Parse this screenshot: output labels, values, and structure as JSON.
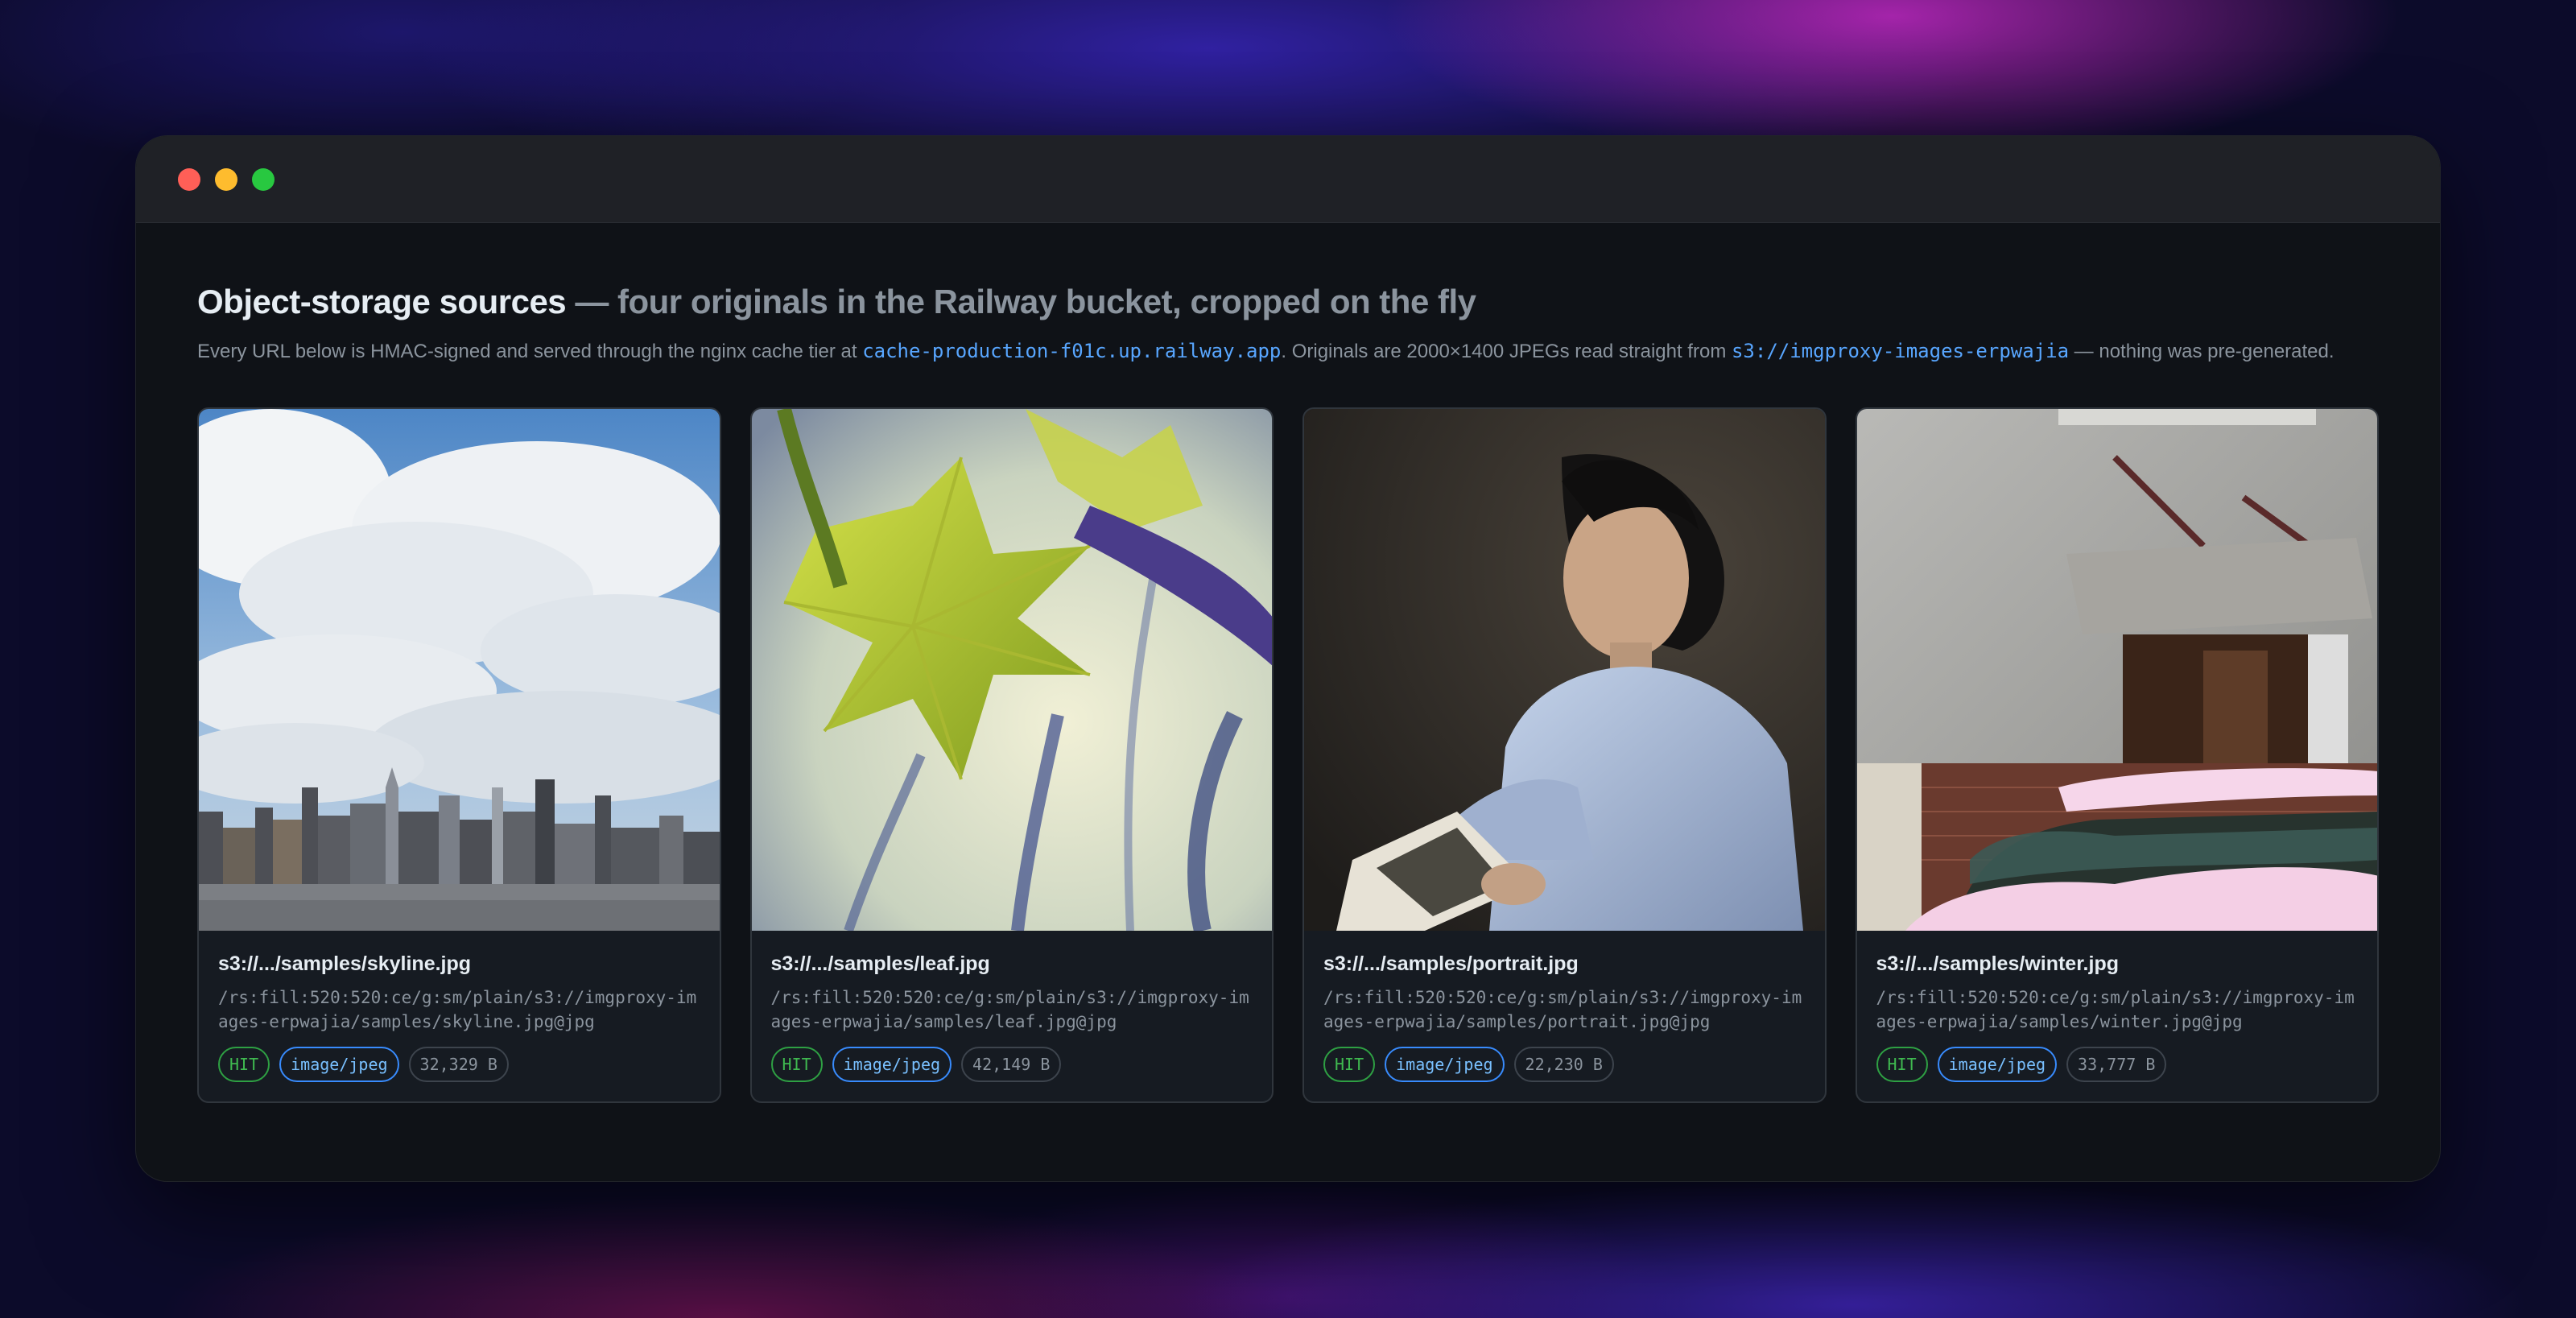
{
  "window": {
    "controls": [
      "close",
      "minimize",
      "zoom"
    ]
  },
  "header": {
    "title_strong": "Object-storage sources",
    "title_rest": " — four originals in the Railway bucket, cropped on the fly",
    "desc_part1": "Every URL below is HMAC-signed and served through the nginx cache tier at ",
    "desc_code1": "cache-production-f01c.up.railway.app",
    "desc_part2": ". Originals are 2000×1400 JPEGs read straight from ",
    "desc_code2": "s3://imgproxy-images-erpwajia",
    "desc_part3": " — nothing was pre-generated."
  },
  "cards": [
    {
      "name": "s3://.../samples/skyline.jpg",
      "path": "/rs:fill:520:520:ce/g:sm/plain/s3://imgproxy-images-erpwajia/samples/skyline.jpg@jpg",
      "cache": "HIT",
      "mime": "image/jpeg",
      "size": "32,329 B"
    },
    {
      "name": "s3://.../samples/leaf.jpg",
      "path": "/rs:fill:520:520:ce/g:sm/plain/s3://imgproxy-images-erpwajia/samples/leaf.jpg@jpg",
      "cache": "HIT",
      "mime": "image/jpeg",
      "size": "42,149 B"
    },
    {
      "name": "s3://.../samples/portrait.jpg",
      "path": "/rs:fill:520:520:ce/g:sm/plain/s3://imgproxy-images-erpwajia/samples/portrait.jpg@jpg",
      "cache": "HIT",
      "mime": "image/jpeg",
      "size": "22,230 B"
    },
    {
      "name": "s3://.../samples/winter.jpg",
      "path": "/rs:fill:520:520:ce/g:sm/plain/s3://imgproxy-images-erpwajia/samples/winter.jpg@jpg",
      "cache": "HIT",
      "mime": "image/jpeg",
      "size": "33,777 B"
    }
  ]
}
